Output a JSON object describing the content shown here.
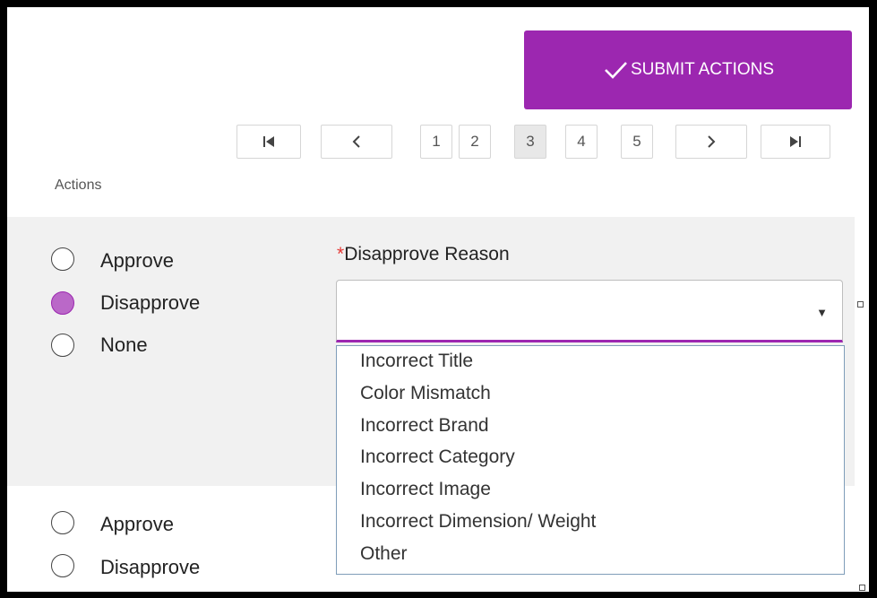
{
  "toolbar": {
    "submit_label": "SUBMIT ACTIONS"
  },
  "pagination": {
    "pages": [
      "1",
      "2",
      "3",
      "4",
      "5"
    ],
    "current_page": "3"
  },
  "actions_header": "Actions",
  "row1": {
    "options": [
      "Approve",
      "Disapprove",
      "None"
    ],
    "selected": "Disapprove",
    "reason_required_mark": "*",
    "reason_label": "Disapprove Reason",
    "reason_value": ""
  },
  "dropdown_options": [
    "Incorrect Title",
    "Color Mismatch",
    "Incorrect Brand",
    "Incorrect Category",
    "Incorrect Image",
    "Incorrect Dimension/ Weight",
    "Other"
  ],
  "row2": {
    "options": [
      "Approve",
      "Disapprove"
    ]
  },
  "colors": {
    "accent": "#9c27b0",
    "radio_checked": "#ba68c8",
    "required": "#e53935"
  }
}
